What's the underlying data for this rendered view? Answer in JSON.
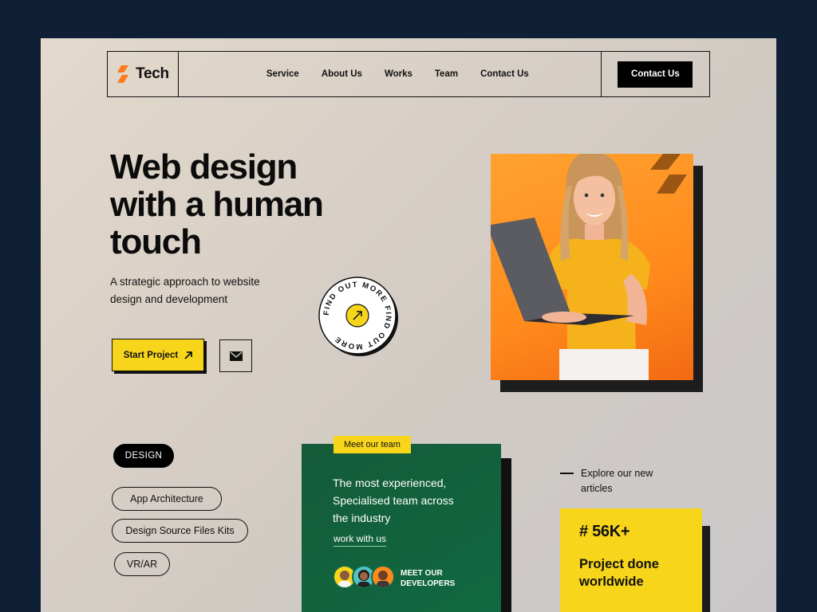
{
  "brand": {
    "name": "Tech",
    "accent": "#f7d51a",
    "orange": "#ff8a1c"
  },
  "nav": {
    "links": [
      "Service",
      "About Us",
      "Works",
      "Team",
      "Contact Us"
    ],
    "cta": "Contact Us"
  },
  "hero": {
    "title": "Web design with a human touch",
    "subtitle": "A strategic approach to website design and development",
    "start_button": "Start Project",
    "badge_text": "FIND OUT MORE FIND OUT MORE"
  },
  "services": {
    "active_tag": "DESIGN",
    "tags": [
      "App Architecture",
      "Design Source Files Kits",
      "VR/AR"
    ]
  },
  "team": {
    "label": "Meet our team",
    "text": "The most experienced, Specialised team across the industry",
    "link": "work with us",
    "developers_line1": "MEET OUR",
    "developers_line2": "DEVELOPERS"
  },
  "articles": {
    "explore_line1": "Explore our new",
    "explore_line2": "articles",
    "stat_number": "# 56K+",
    "stat_text": "Project done worldwide"
  }
}
